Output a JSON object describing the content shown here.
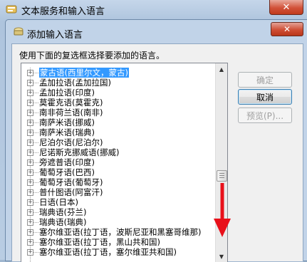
{
  "outer_window": {
    "title": "文本服务和输入语言",
    "close_glyph": "✕"
  },
  "dialog": {
    "title": "添加输入语言",
    "close_glyph": "✕",
    "instruction": "使用下面的复选框选择要添加的语言。",
    "buttons": {
      "ok": "确定",
      "cancel": "取消",
      "preview": "预览(P)..."
    }
  },
  "language_list": {
    "selected_index": 0,
    "items": [
      "蒙古语(西里尔文，蒙古)",
      "孟加拉语(孟加拉国)",
      "孟加拉语(印度)",
      "莫霍克语(莫霍克)",
      "南非荷兰语(南非)",
      "南萨米语(挪威)",
      "南萨米语(瑞典)",
      "尼泊尔语(尼泊尔)",
      "尼诺斯克挪威语(挪威)",
      "旁遮普语(印度)",
      "葡萄牙语(巴西)",
      "葡萄牙语(葡萄牙)",
      "普什图语(阿富汗)",
      "日语(日本)",
      "瑞典语(芬兰)",
      "瑞典语(瑞典)",
      "塞尔维亚语(拉丁语，波斯尼亚和黑塞哥维那)",
      "塞尔维亚语(拉丁语，黑山共和国)",
      "塞尔维亚语(拉丁语，塞尔维亚共和国)"
    ]
  },
  "colors": {
    "selection": "#3399ff",
    "annotation_arrow": "#e8101a"
  }
}
